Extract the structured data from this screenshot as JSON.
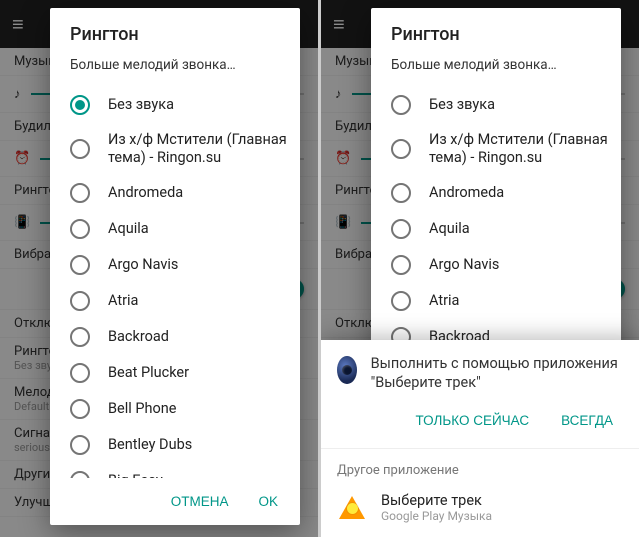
{
  "bg": {
    "rows": [
      "Музык",
      "Будильн",
      "Рингто",
      "Вибрац",
      "Отклю",
      "Рингто",
      "Мелод",
      "Сигнал",
      "Другие",
      "Улучше"
    ],
    "subs": {
      "5": "Без звук",
      "6": "Default",
      "7": "serious,\nencounte"
    }
  },
  "dialog": {
    "title": "Рингтон",
    "more": "Больше мелодий звонка…",
    "cancel": "ОТМЕНА",
    "ok": "OK",
    "selected_left": 0,
    "options": [
      "Без звука",
      "Из х/ф Мстители (Главная тема) - Ringon.su",
      "Andromeda",
      "Aquila",
      "Argo Navis",
      "Atria",
      "Backroad",
      "Beat Plucker",
      "Bell Phone",
      "Bentley Dubs",
      "Big Easy"
    ],
    "options_right": [
      "Без звука",
      "Из х/ф Мстители (Главная тема) - Ringon.su",
      "Andromeda",
      "Aquila",
      "Argo Navis",
      "Atria",
      "Backroad"
    ]
  },
  "sheet": {
    "prompt": "Выполнить с помощью приложения \"Выберите трек\"",
    "just_once": "ТОЛЬКО СЕЙЧАС",
    "always": "ВСЕГДА",
    "other_app_header": "Другое приложение",
    "app_title": "Выберите трек",
    "app_sub": "Google Play Музыка"
  }
}
